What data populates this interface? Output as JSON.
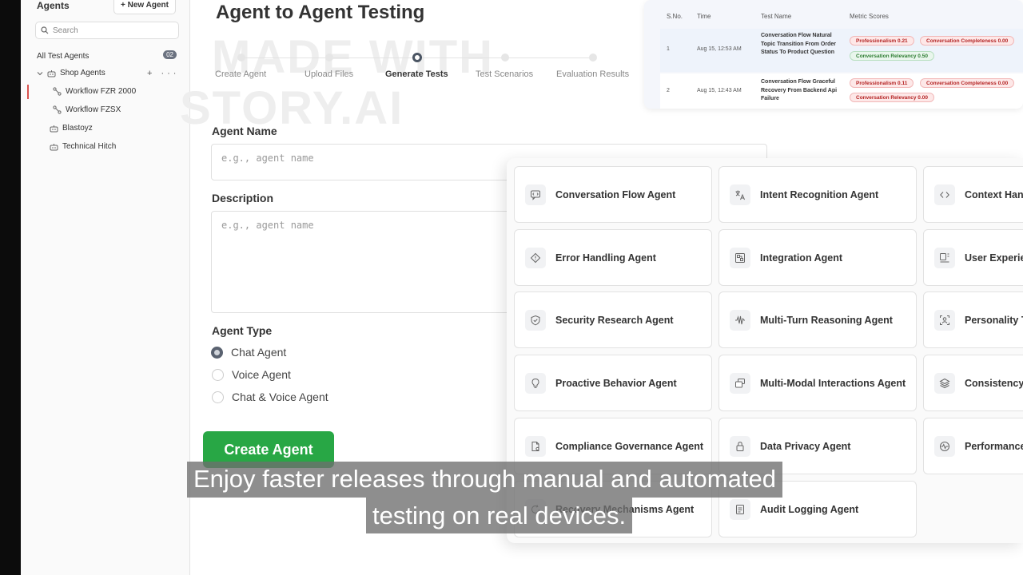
{
  "sidebar": {
    "title": "Agents",
    "new_agent_label": "+ New Agent",
    "search_placeholder": "Search",
    "all_tests_label": "All Test Agents",
    "all_tests_count": "02",
    "group_label": "Shop Agents",
    "group_actions": "+ ···",
    "items": [
      {
        "label": "Workflow FZR 2000"
      },
      {
        "label": "Workflow FZSX"
      },
      {
        "label": "Blastoyz"
      },
      {
        "label": "Technical Hitch"
      }
    ]
  },
  "watermark": {
    "line1": "MADE WITH",
    "line2": "STORY.AI"
  },
  "page": {
    "title": "Agent to Agent Testing"
  },
  "stepper": {
    "steps": [
      {
        "label": "Create Agent"
      },
      {
        "label": "Upload Files"
      },
      {
        "label": "Generate Tests"
      },
      {
        "label": "Test Scenarios"
      },
      {
        "label": "Evaluation Results"
      }
    ],
    "active_index": 2
  },
  "form": {
    "name_label": "Agent Name",
    "name_placeholder": "e.g., agent name",
    "description_label": "Description",
    "description_placeholder": "e.g., agent name",
    "type_label": "Agent Type",
    "type_options": [
      {
        "label": "Chat Agent",
        "checked": true
      },
      {
        "label": "Voice Agent",
        "checked": false
      },
      {
        "label": "Chat & Voice Agent",
        "checked": false
      }
    ],
    "create_button": "Create Agent",
    "accent_color": "#28a745"
  },
  "results": {
    "headers": {
      "sno": "S.No.",
      "time": "Time",
      "name": "Test Name",
      "metrics": "Metric Scores"
    },
    "rows": [
      {
        "sno": "1",
        "time": "Aug 15, 12:53 AM",
        "name": "Conversation Flow Natural Topic Transition From Order Status To Product Question",
        "metrics": [
          {
            "label": "Professionalism 0.21",
            "status": "red"
          },
          {
            "label": "Conversation Completeness 0.00",
            "status": "red"
          },
          {
            "label": "Conversation Relevancy 0.50",
            "status": "green"
          }
        ]
      },
      {
        "sno": "2",
        "time": "Aug 15, 12:43 AM",
        "name": "Conversation Flow Graceful Recovery From Backend Api Failure",
        "metrics": [
          {
            "label": "Professionalism 0.11",
            "status": "red"
          },
          {
            "label": "Conversation Completeness 0.00",
            "status": "red"
          },
          {
            "label": "Conversation Relevancy 0.00",
            "status": "red"
          }
        ]
      }
    ]
  },
  "agent_types": [
    {
      "label": "Conversation Flow Agent",
      "icon": "chat-code-icon"
    },
    {
      "label": "Intent Recognition Agent",
      "icon": "translate-icon"
    },
    {
      "label": "Context Han",
      "icon": "code-brackets-icon"
    },
    {
      "label": "Error Handling Agent",
      "icon": "diamond-alert-icon"
    },
    {
      "label": "Integration Agent",
      "icon": "integration-icon"
    },
    {
      "label": "User Experie",
      "icon": "layout-icon"
    },
    {
      "label": "Security Research Agent",
      "icon": "shield-icon"
    },
    {
      "label": "Multi-Turn Reasoning Agent",
      "icon": "waveform-icon"
    },
    {
      "label": "Personality T",
      "icon": "user-scan-icon"
    },
    {
      "label": "Proactive Behavior Agent",
      "icon": "lightbulb-icon"
    },
    {
      "label": "Multi-Modal Interactions Agent",
      "icon": "layers-copy-icon"
    },
    {
      "label": "Consistency",
      "icon": "stack-icon"
    },
    {
      "label": "Compliance Governance Agent",
      "icon": "document-icon"
    },
    {
      "label": "Data Privacy Agent",
      "icon": "lock-icon"
    },
    {
      "label": "Performance",
      "icon": "gauge-icon"
    },
    {
      "label": "Recovery Mechanisms Agent",
      "icon": "refresh-icon"
    },
    {
      "label": "Audit Logging Agent",
      "icon": "list-document-icon"
    }
  ],
  "subtitles": {
    "line1": "Enjoy faster releases through manual and automated",
    "line2": "testing on real devices."
  }
}
